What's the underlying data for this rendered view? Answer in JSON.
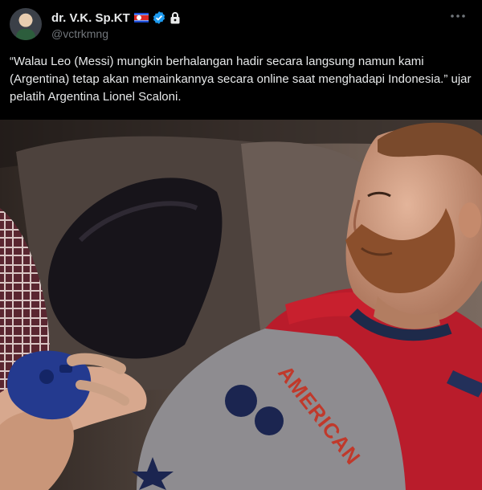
{
  "tweet": {
    "author": {
      "name": "dr. V.K. Sp.KT",
      "handle": "@vctrkmng"
    },
    "text": "“Walau Leo (Messi) mungkin berhalangan hadir secara langsung namun kami (Argentina) tetap akan memainkannya secara online saat menghadapi Indonesia.” ujar pelatih Argentina Lionel Scaloni.",
    "media": {
      "shirt_print": "AMERICAN"
    }
  },
  "colors": {
    "background": "#000000",
    "text": "#e7e9ea",
    "secondary_text": "#71767b",
    "verified": "#1d9bf0"
  },
  "icons": [
    "avatar",
    "korea-flag-icon",
    "verified-badge-icon",
    "lock-icon",
    "more-options-icon"
  ]
}
